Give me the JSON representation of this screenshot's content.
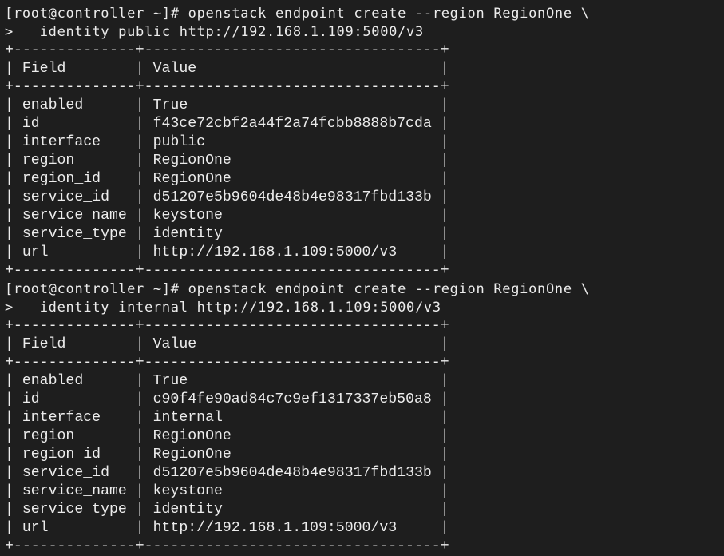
{
  "terminal": {
    "prompt": "[root@controller ~]# ",
    "continuation": ">   ",
    "border": "+--------------+----------------------------------+",
    "header": {
      "field": "Field",
      "value": "Value"
    },
    "blocks": [
      {
        "command": "openstack endpoint create --region RegionOne \\",
        "continuation_text": "identity public http://192.168.1.109:5000/v3",
        "rows": [
          {
            "field": "enabled",
            "value": "True"
          },
          {
            "field": "id",
            "value": "f43ce72cbf2a44f2a74fcbb8888b7cda"
          },
          {
            "field": "interface",
            "value": "public"
          },
          {
            "field": "region",
            "value": "RegionOne"
          },
          {
            "field": "region_id",
            "value": "RegionOne"
          },
          {
            "field": "service_id",
            "value": "d51207e5b9604de48b4e98317fbd133b"
          },
          {
            "field": "service_name",
            "value": "keystone"
          },
          {
            "field": "service_type",
            "value": "identity"
          },
          {
            "field": "url",
            "value": "http://192.168.1.109:5000/v3"
          }
        ]
      },
      {
        "command": "openstack endpoint create --region RegionOne \\",
        "continuation_text": "identity internal http://192.168.1.109:5000/v3",
        "rows": [
          {
            "field": "enabled",
            "value": "True"
          },
          {
            "field": "id",
            "value": "c90f4fe90ad84c7c9ef1317337eb50a8"
          },
          {
            "field": "interface",
            "value": "internal"
          },
          {
            "field": "region",
            "value": "RegionOne"
          },
          {
            "field": "region_id",
            "value": "RegionOne"
          },
          {
            "field": "service_id",
            "value": "d51207e5b9604de48b4e98317fbd133b"
          },
          {
            "field": "service_name",
            "value": "keystone"
          },
          {
            "field": "service_type",
            "value": "identity"
          },
          {
            "field": "url",
            "value": "http://192.168.1.109:5000/v3"
          }
        ]
      }
    ]
  }
}
